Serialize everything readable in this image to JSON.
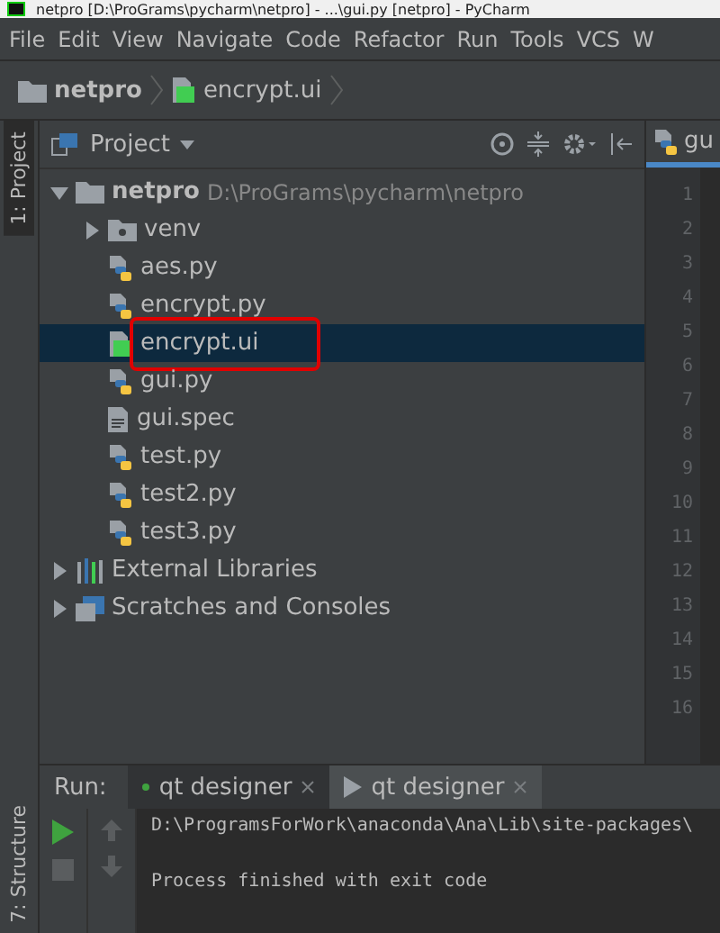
{
  "title": "netpro [D:\\ProGrams\\pycharm\\netpro] - ...\\gui.py [netpro] - PyCharm",
  "menu": [
    "File",
    "Edit",
    "View",
    "Navigate",
    "Code",
    "Refactor",
    "Run",
    "Tools",
    "VCS",
    "W"
  ],
  "breadcrumb": [
    {
      "label": "netpro",
      "kind": "folder"
    },
    {
      "label": "encrypt.ui",
      "kind": "qt"
    }
  ],
  "side_tabs": [
    {
      "label": "1: Project",
      "selected": true
    },
    {
      "label": "7: Structure",
      "selected": false
    }
  ],
  "project_panel": {
    "title": "Project"
  },
  "tree": [
    {
      "label": "netpro",
      "path": "D:\\ProGrams\\pycharm\\netpro",
      "kind": "folder",
      "expanded": true,
      "selected": false,
      "children": [
        {
          "label": "venv",
          "kind": "folder",
          "expanded": false,
          "selected": false
        },
        {
          "label": "aes.py",
          "kind": "python",
          "selected": false
        },
        {
          "label": "encrypt.py",
          "kind": "python",
          "selected": false
        },
        {
          "label": "encrypt.ui",
          "kind": "qt",
          "selected": true
        },
        {
          "label": "gui.py",
          "kind": "python",
          "selected": false
        },
        {
          "label": "gui.spec",
          "kind": "text",
          "selected": false
        },
        {
          "label": "test.py",
          "kind": "python",
          "selected": false
        },
        {
          "label": "test2.py",
          "kind": "python",
          "selected": false
        },
        {
          "label": "test3.py",
          "kind": "python",
          "selected": false
        }
      ]
    },
    {
      "label": "External Libraries",
      "kind": "libraries",
      "expanded": false,
      "selected": false
    },
    {
      "label": "Scratches and Consoles",
      "kind": "scratches",
      "expanded": false,
      "selected": false
    }
  ],
  "editor": {
    "tab": "gu",
    "line_numbers": [
      "1",
      "2",
      "3",
      "4",
      "5",
      "6",
      "7",
      "8",
      "9",
      "10",
      "11",
      "12",
      "13",
      "14",
      "15",
      "16"
    ]
  },
  "run_panel": {
    "label": "Run:",
    "tabs": [
      {
        "label": "qt designer",
        "kind": "running",
        "selected": false
      },
      {
        "label": "qt designer",
        "kind": "play",
        "selected": true
      }
    ],
    "console": [
      "D:\\ProgramsForWork\\anaconda\\Ana\\Lib\\site-packages\\",
      "Process finished with exit code"
    ]
  }
}
